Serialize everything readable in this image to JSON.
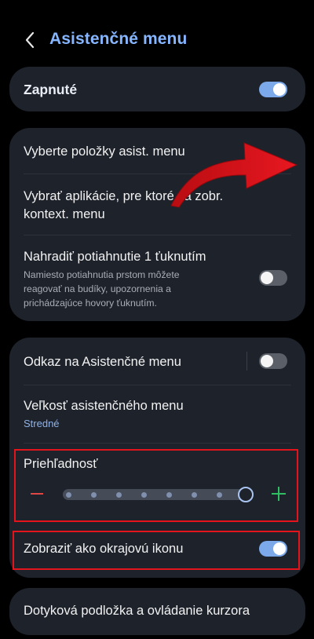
{
  "header": {
    "title": "Asistenčné menu"
  },
  "main_toggle": {
    "label": "Zapnuté",
    "state": "on"
  },
  "section1": {
    "items": [
      {
        "label": "Vyberte položky asist. menu"
      },
      {
        "label_line1": "Vybrať aplikácie, pre ktoré sa zobr.",
        "label_line2": "kontext. menu"
      },
      {
        "label": "Nahradiť potiahnutie 1 ťuknutím",
        "desc_line1": "Namiesto potiahnutia prstom môžete",
        "desc_line2": "reagovať na budíky, upozornenia a",
        "desc_line3": "prichádzajúce hovory ťuknutím.",
        "state": "off"
      }
    ]
  },
  "section2": {
    "shortcut": {
      "label": "Odkaz na Asistenčné menu",
      "state": "off"
    },
    "size": {
      "label": "Veľkosť asistenčného menu",
      "value": "Stredné"
    },
    "transparency": {
      "label": "Priehľadnosť",
      "level_fraction": 1.0,
      "steps": 8
    },
    "edge_icon": {
      "label": "Zobraziť ako okrajovú ikonu",
      "state": "on"
    }
  },
  "section3": {
    "label": "Dotyková podložka a ovládanie kurzora"
  },
  "colors": {
    "accent": "#86b6ff",
    "card": "#1e222b",
    "highlight": "#e3141b",
    "minus": "#e04646",
    "plus": "#2fbf62"
  }
}
